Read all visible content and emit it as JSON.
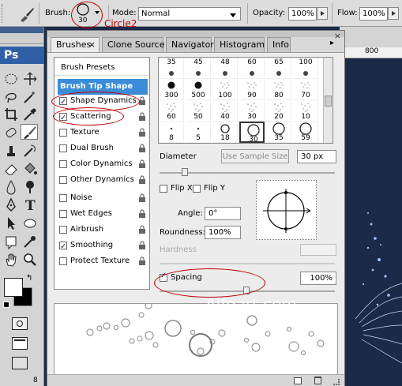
{
  "options_bar": {
    "brush_label": "Brush:",
    "brush_size": "30",
    "brush_name_annotation": "Circle2",
    "mode_label": "Mode:",
    "mode_value": "Normal",
    "opacity_label": "Opacity:",
    "opacity_value": "100%",
    "flow_label": "Flow:",
    "flow_value": "100%"
  },
  "tools_panel": {
    "logo": "Ps",
    "bottom_value": "8"
  },
  "canvas": {
    "ruler_label": "800"
  },
  "panel": {
    "tabs": [
      {
        "label": "Brushes"
      },
      {
        "label": "Clone Source"
      },
      {
        "label": "Navigator"
      },
      {
        "label": "Histogram"
      },
      {
        "label": "Info"
      }
    ],
    "close_glyph": "×",
    "brush_presets_label": "Brush Presets",
    "brush_tip_shape_label": "Brush Tip Shape",
    "options": [
      {
        "label": "Shape Dynamics",
        "checked": true
      },
      {
        "label": "Scattering",
        "checked": true
      },
      {
        "label": "Texture",
        "checked": false
      },
      {
        "label": "Dual Brush",
        "checked": false
      },
      {
        "label": "Color Dynamics",
        "checked": false
      },
      {
        "label": "Other Dynamics",
        "checked": false
      },
      {
        "label": "Noise",
        "checked": false
      },
      {
        "label": "Wet Edges",
        "checked": false
      },
      {
        "label": "Airbrush",
        "checked": false
      },
      {
        "label": "Smoothing",
        "checked": true
      },
      {
        "label": "Protect Texture",
        "checked": false
      }
    ],
    "brush_thumbs": [
      [
        "35",
        "45",
        "48",
        "60",
        "65",
        "100"
      ],
      [
        "300",
        "500",
        "100",
        "90",
        "80",
        "70"
      ],
      [
        "60",
        "50",
        "40",
        "30",
        "20",
        "10"
      ],
      [
        "8",
        "5",
        "18",
        "30",
        "35",
        "59"
      ]
    ],
    "diameter_label": "Diameter",
    "use_sample_size_label": "Use Sample Size",
    "diameter_value": "30 px",
    "flip_x_label": "Flip X",
    "flip_y_label": "Flip Y",
    "angle_label": "Angle:",
    "angle_value": "0°",
    "roundness_label": "Roundness:",
    "roundness_value": "100%",
    "hardness_label": "Hardness",
    "spacing_label": "Spacing",
    "spacing_checked": true,
    "spacing_value": "100%",
    "watermark": "Alfoart.com"
  },
  "colors": {
    "annotation_red": "#c00000",
    "selection_blue": "#3a8bd8",
    "canvas_bg": "#1b2a48"
  }
}
